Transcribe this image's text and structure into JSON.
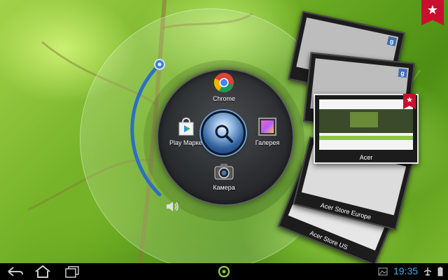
{
  "launcher": {
    "apps": [
      {
        "label": "Chrome",
        "icon": "chrome-icon"
      },
      {
        "label": "Play Маркет",
        "icon": "play-store-icon"
      },
      {
        "label": "Галерея",
        "icon": "gallery-icon"
      },
      {
        "label": "Камера",
        "icon": "camera-icon"
      }
    ],
    "center_icon": "search-icon",
    "volume_icon": "speaker-icon"
  },
  "recent_cards": [
    {
      "caption": "",
      "badge": "g"
    },
    {
      "caption": "",
      "badge": "g"
    },
    {
      "caption": "Acer",
      "bookmark": "★"
    },
    {
      "caption": "Acer Store Europe"
    },
    {
      "caption": "Acer Store US"
    }
  ],
  "corner_bookmark": "★",
  "status_bar": {
    "time": "19:35",
    "time_color": "#3bb0e8",
    "icons": [
      "back-icon",
      "home-icon",
      "recent-apps-icon",
      "launcher-ring-icon",
      "image-notification-icon",
      "airplane-icon",
      "battery-icon"
    ]
  }
}
